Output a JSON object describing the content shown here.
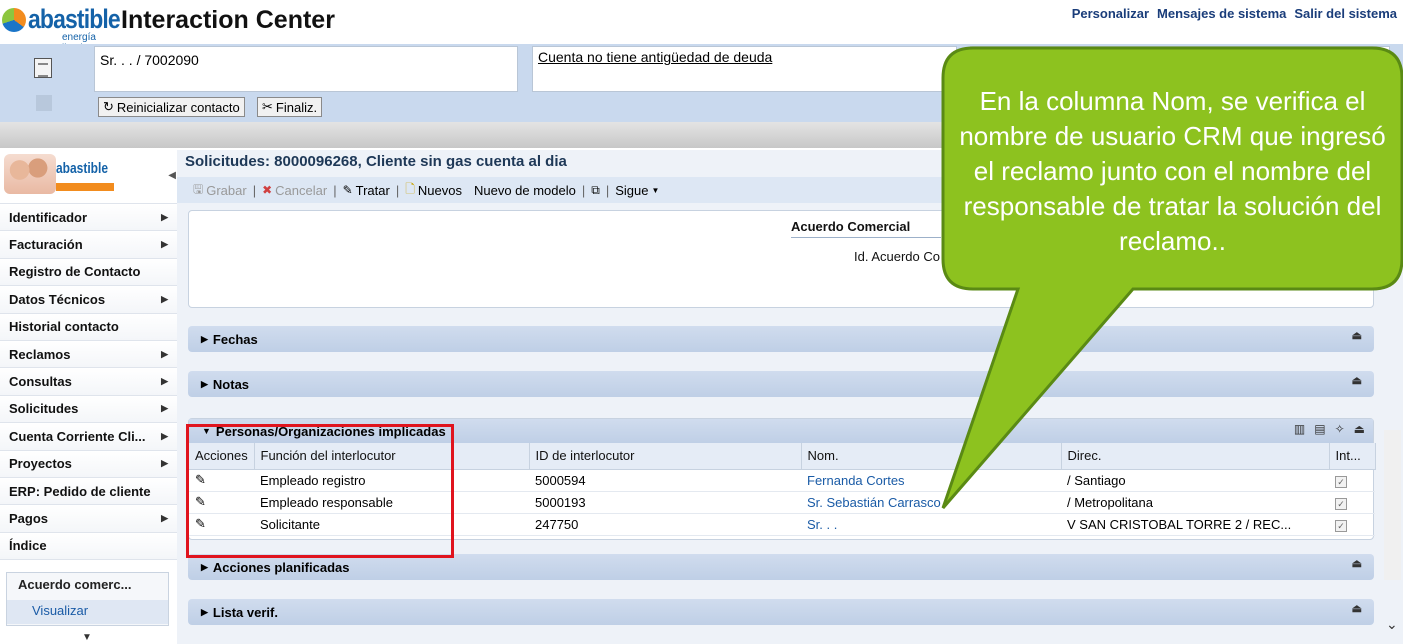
{
  "app": {
    "logo_word": "abastible",
    "logo_tag": "energía limpia",
    "title": "Interaction Center",
    "top_links": [
      "Personalizar",
      "Mensajes de sistema",
      "Salir del sistema"
    ]
  },
  "header": {
    "bp_text": "Sr. . . / 7002090",
    "debt_text": "Cuenta no tiene antigüedad de deuda",
    "buttons": {
      "reset": "Reinicializar contacto",
      "end": "Finaliz."
    }
  },
  "nav": {
    "logo_name": "abastible",
    "items": [
      {
        "label": "Identificador",
        "arrow": true
      },
      {
        "label": "Facturación",
        "arrow": true
      },
      {
        "label": "Registro de Contacto",
        "arrow": false
      },
      {
        "label": "Datos Técnicos",
        "arrow": true
      },
      {
        "label": "Historial contacto",
        "arrow": false
      },
      {
        "label": "Reclamos",
        "arrow": true
      },
      {
        "label": "Consultas",
        "arrow": true
      },
      {
        "label": "Solicitudes",
        "arrow": true
      },
      {
        "label": "Cuenta Corriente Cli...",
        "arrow": true
      },
      {
        "label": "Proyectos",
        "arrow": true
      },
      {
        "label": "ERP: Pedido de cliente",
        "arrow": false
      },
      {
        "label": "Pagos",
        "arrow": true
      },
      {
        "label": "Índice",
        "arrow": false
      }
    ],
    "recent_title": "Acuerdo comerc...",
    "recent_link": "Visualizar"
  },
  "main": {
    "page_title": "Solicitudes: 8000096268, Cliente sin gas cuenta al dia",
    "toolbar": {
      "save": "Grabar",
      "cancel": "Cancelar",
      "treat": "Tratar",
      "new": "Nuevos",
      "new_model": "Nuevo de modelo",
      "follow": "Sigue"
    },
    "card": {
      "heading": "Acuerdo Comercial",
      "field": "Id. Acuerdo Co"
    },
    "sections": {
      "dates": "Fechas",
      "notes": "Notas",
      "planned": "Acciones planificadas",
      "checklist": "Lista verif."
    },
    "parties": {
      "title": "Personas/Organizaciones implicadas",
      "columns": [
        "Acciones",
        "Función del interlocutor",
        "ID de interlocutor",
        "Nom.",
        "Direc.",
        "Int..."
      ],
      "rows": [
        {
          "function": "Empleado registro",
          "id": "5000594",
          "name": "Fernanda Cortes",
          "address": "/ Santiago"
        },
        {
          "function": "Empleado responsable",
          "id": "5000193",
          "name": "Sr. Sebastián Carrasco",
          "address": "/ Metropolitana"
        },
        {
          "function": "Solicitante",
          "id": "247750",
          "name": "Sr. . .",
          "address": "V SAN CRISTOBAL TORRE 2 / REC..."
        }
      ]
    }
  },
  "callout": {
    "text": "En la columna Nom, se verifica el nombre de usuario CRM que ingresó el reclamo junto con el nombre del responsable de tratar la solución del reclamo..",
    "fill": "#8dc21f",
    "stroke": "#5a8a14"
  }
}
